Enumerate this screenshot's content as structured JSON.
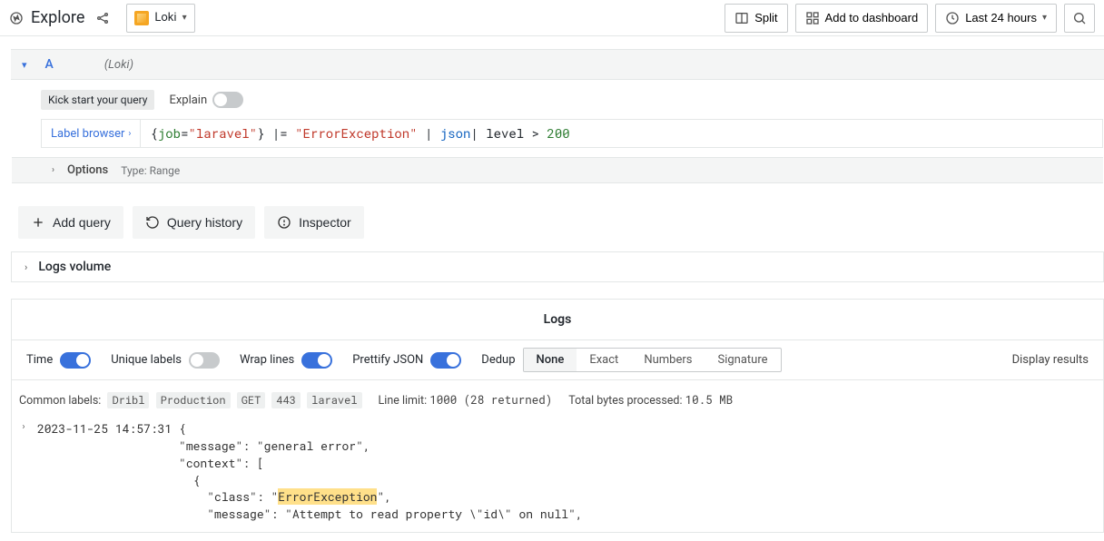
{
  "toolbar": {
    "title": "Explore",
    "datasource": "Loki",
    "split": "Split",
    "add_to_dashboard": "Add to dashboard",
    "time_range": "Last 24 hours"
  },
  "query": {
    "letter": "A",
    "ds_hint": "(Loki)",
    "kick_label": "Kick start your query",
    "explain_label": "Explain",
    "label_browser": "Label browser",
    "tokens": {
      "key": "job",
      "val": "\"laravel\"",
      "filter_str": "\"ErrorException\"",
      "json_kw": "json",
      "level_kw": "level",
      "num": "200"
    },
    "options_label": "Options",
    "type_text": "Type: Range"
  },
  "actions": {
    "add_query": "Add query",
    "query_history": "Query history",
    "inspector": "Inspector"
  },
  "sections": {
    "logs_volume": "Logs volume"
  },
  "logs": {
    "title": "Logs",
    "controls": {
      "time": "Time",
      "unique": "Unique labels",
      "wrap": "Wrap lines",
      "pretty": "Prettify JSON",
      "dedup_label": "Dedup",
      "dedup_options": [
        "None",
        "Exact",
        "Numbers",
        "Signature"
      ],
      "display_results": "Display results"
    },
    "meta": {
      "common_labels_label": "Common labels:",
      "common_labels": [
        "Dribl",
        "Production",
        "GET",
        "443",
        "laravel"
      ],
      "line_limit_label": "Line limit:",
      "line_limit_value": "1000 (28 returned)",
      "bytes_label": "Total bytes processed:",
      "bytes_value": "10.5 MB"
    },
    "entry": {
      "ts": "2023-11-25 14:57:31",
      "msg_key": "\"message\"",
      "msg_val": "\"general error\"",
      "ctx_key": "\"context\"",
      "class_key": "\"class\"",
      "class_val_pre": "\"",
      "class_val_hl": "ErrorException",
      "class_val_post": "\"",
      "inner_msg_key": "\"message\"",
      "inner_msg_val": "\"Attempt to read property \\\"id\\\" on null\""
    }
  }
}
